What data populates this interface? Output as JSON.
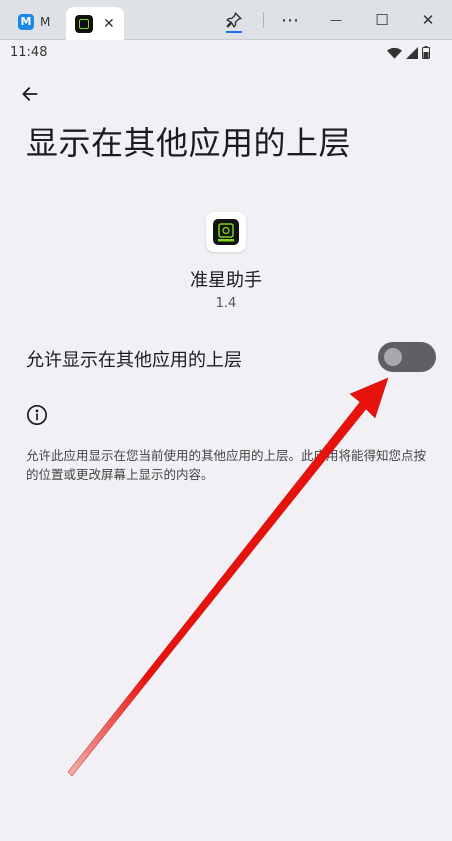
{
  "browser": {
    "tabs": [
      {
        "label": "M",
        "active": false
      },
      {
        "label": "",
        "active": true
      }
    ],
    "close_glyph": "✕",
    "pin_icon": "pin-icon",
    "menu_glyph": "⋯",
    "minimize_glyph": "—",
    "maximize_glyph": "☐",
    "window_close_glyph": "✕"
  },
  "status_bar": {
    "time": "11:48",
    "icons": [
      "wifi-icon",
      "signal-icon",
      "battery-icon"
    ]
  },
  "page": {
    "title": "显示在其他应用的上层",
    "back_icon": "arrow-left-icon"
  },
  "app": {
    "name": "准星助手",
    "version": "1.4"
  },
  "setting": {
    "label": "允许显示在其他应用的上层",
    "enabled": false
  },
  "description": "允许此应用显示在您当前使用的其他应用的上层。此应用将能得知您点按的位置或更改屏幕上显示的内容。",
  "colors": {
    "background": "#f2f0f4",
    "toggle_track": "#5f6063",
    "toggle_knob": "#a8a9ad",
    "annotation_arrow": "#e8120c"
  }
}
